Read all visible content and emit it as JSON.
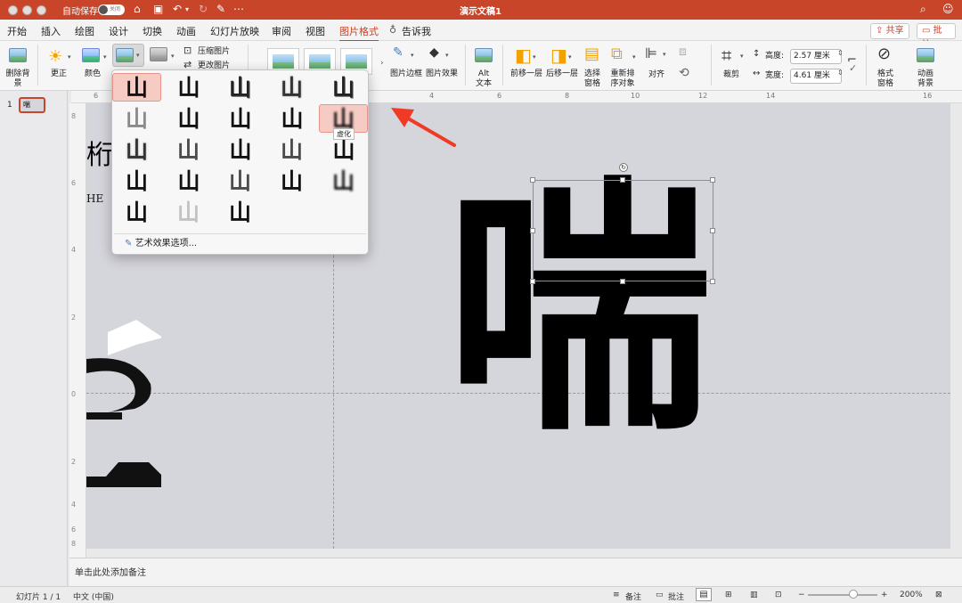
{
  "titlebar": {
    "autosave_label": "自动保存",
    "autosave_state": "关闭",
    "doc_title": "演示文稿1"
  },
  "tabs": [
    "开始",
    "插入",
    "绘图",
    "设计",
    "切换",
    "动画",
    "幻灯片放映",
    "审阅",
    "视图",
    "图片格式"
  ],
  "tell_me": "告诉我",
  "share_label": "共享",
  "comments_label": "批注",
  "ribbon": {
    "remove_bg": "删除背景",
    "corrections": "更正",
    "color": "颜色",
    "compress": "压缩图片",
    "change": "更改图片",
    "picture_border": "图片边框",
    "picture_effects": "图片效果",
    "alt_text": "Alt 文本",
    "bring_forward": "前移一层",
    "send_backward": "后移一层",
    "selection_pane": "选择窗格",
    "reorder": "重新排序对象",
    "align": "对齐",
    "crop": "裁剪",
    "height_label": "高度:",
    "height_value": "2.57 厘米",
    "width_label": "宽度:",
    "width_value": "4.61 厘米",
    "format_pane": "格式窗格",
    "animate_bg": "动画背景"
  },
  "gallery": {
    "glyph": "山",
    "tooltip": "虚化",
    "options_label": "艺术效果选项..."
  },
  "slide": {
    "number": "1",
    "main_char": "喘",
    "left_char": "桁",
    "left_text": "HE"
  },
  "ruler_h": [
    "6",
    "4",
    "2",
    "0",
    "2",
    "4",
    "6",
    "8",
    "10",
    "12",
    "14",
    "16"
  ],
  "ruler_v": [
    "8",
    "6",
    "4",
    "2",
    "0",
    "2",
    "4",
    "6",
    "8"
  ],
  "notes_placeholder": "单击此处添加备注",
  "status": {
    "slide_info": "幻灯片 1 / 1",
    "language": "中文 (中国)",
    "notes": "备注",
    "comments": "批注",
    "zoom": "200%"
  },
  "colors": {
    "accent": "#c8452a",
    "canvas": "#d5d5dc"
  }
}
